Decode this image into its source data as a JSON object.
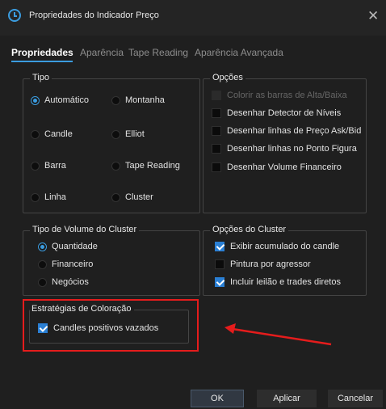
{
  "window": {
    "title": "Propriedades do Indicador Preço"
  },
  "tabs": [
    {
      "label": "Propriedades",
      "active": true
    },
    {
      "label": "Aparência",
      "active": false
    },
    {
      "label": "Tape Reading",
      "active": false
    },
    {
      "label": "Aparência Avançada",
      "active": false
    }
  ],
  "tipo": {
    "title": "Tipo",
    "options": [
      {
        "label": "Automático",
        "selected": true
      },
      {
        "label": "Montanha",
        "selected": false
      },
      {
        "label": "Candle",
        "selected": false
      },
      {
        "label": "Elliot",
        "selected": false
      },
      {
        "label": "Barra",
        "selected": false
      },
      {
        "label": "Tape Reading",
        "selected": false
      },
      {
        "label": "Linha",
        "selected": false
      },
      {
        "label": "Cluster",
        "selected": false
      }
    ]
  },
  "opcoes": {
    "title": "Opções",
    "items": [
      {
        "label": "Colorir as barras de Alta/Baixa",
        "checked": false,
        "disabled": true
      },
      {
        "label": "Desenhar Detector de Níveis",
        "checked": false,
        "disabled": false
      },
      {
        "label": "Desenhar linhas de Preço Ask/Bid",
        "checked": false,
        "disabled": false
      },
      {
        "label": "Desenhar linhas no Ponto Figura",
        "checked": false,
        "disabled": false
      },
      {
        "label": "Desenhar Volume Financeiro",
        "checked": false,
        "disabled": false
      }
    ]
  },
  "volume_cluster": {
    "title": "Tipo de Volume do Cluster",
    "options": [
      {
        "label": "Quantidade",
        "selected": true
      },
      {
        "label": "Financeiro",
        "selected": false
      },
      {
        "label": "Negócios",
        "selected": false
      }
    ]
  },
  "opcoes_cluster": {
    "title": "Opções do Cluster",
    "items": [
      {
        "label": "Exibir acumulado do candle",
        "checked": true
      },
      {
        "label": "Pintura por agressor",
        "checked": false
      },
      {
        "label": "Incluir leilão e trades diretos",
        "checked": true
      }
    ]
  },
  "estrategias": {
    "title": "Estratégias de Coloração",
    "items": [
      {
        "label": "Candles positivos vazados",
        "checked": true
      }
    ]
  },
  "buttons": {
    "ok": "OK",
    "apply": "Aplicar",
    "cancel": "Cancelar"
  },
  "colors": {
    "accent": "#3b9cdf",
    "highlight": "#e51c1c",
    "background": "#1f1f1f"
  },
  "icons": {
    "title": "clock-icon",
    "close": "close-icon"
  }
}
